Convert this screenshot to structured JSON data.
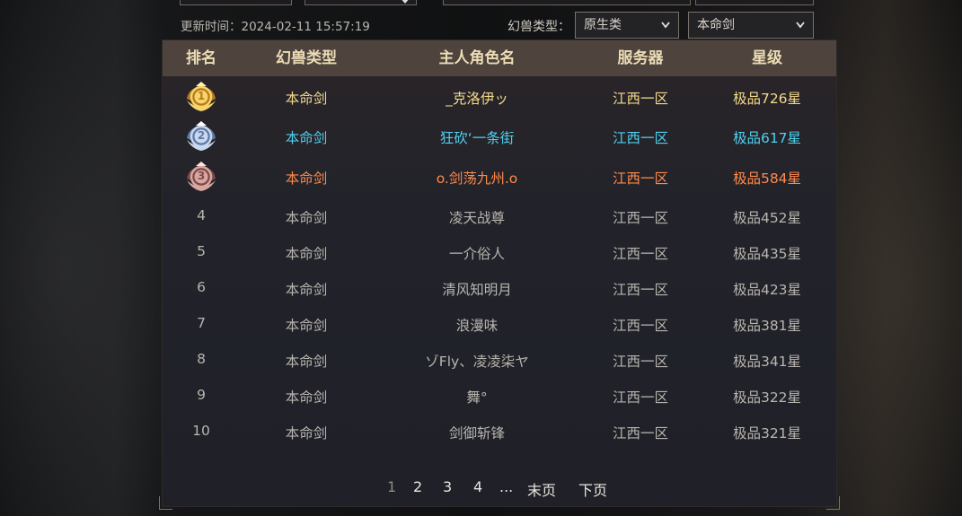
{
  "update_time": "更新时间：2024-02-11 15:57:19",
  "filters": {
    "label": "幻兽类型：",
    "type_select": "原生类",
    "name_select": "本命剑"
  },
  "table": {
    "headers": [
      "排名",
      "幻兽类型",
      "主人角色名",
      "服务器",
      "星级"
    ],
    "rows": [
      {
        "rank": "1",
        "beast_type": "本命剑",
        "owner": "_克洛伊ッ",
        "server": "江西一区",
        "stars": "极品726星",
        "medal": "gold-rank-1-medal"
      },
      {
        "rank": "2",
        "beast_type": "本命剑",
        "owner": "狂砍‘一条街",
        "server": "江西一区",
        "stars": "极品617星",
        "medal": "silver-rank-2-medal"
      },
      {
        "rank": "3",
        "beast_type": "本命剑",
        "owner": "o.剑荡九州.o",
        "server": "江西一区",
        "stars": "极品584星",
        "medal": "bronze-rank-3-medal"
      },
      {
        "rank": "4",
        "beast_type": "本命剑",
        "owner": "凌天战尊",
        "server": "江西一区",
        "stars": "极品452星"
      },
      {
        "rank": "5",
        "beast_type": "本命剑",
        "owner": "一介俗人",
        "server": "江西一区",
        "stars": "极品435星"
      },
      {
        "rank": "6",
        "beast_type": "本命剑",
        "owner": "清风知明月",
        "server": "江西一区",
        "stars": "极品423星"
      },
      {
        "rank": "7",
        "beast_type": "本命剑",
        "owner": "浪漫味",
        "server": "江西一区",
        "stars": "极品381星"
      },
      {
        "rank": "8",
        "beast_type": "本命剑",
        "owner": "ゾFly、凌凌柒ヤ",
        "server": "江西一区",
        "stars": "极品341星"
      },
      {
        "rank": "9",
        "beast_type": "本命剑",
        "owner": "舞°",
        "server": "江西一区",
        "stars": "极品322星"
      },
      {
        "rank": "10",
        "beast_type": "本命剑",
        "owner": "剑御斩锋",
        "server": "江西一区",
        "stars": "极品321星"
      }
    ]
  },
  "pagination": {
    "pages": [
      "1",
      "2",
      "3",
      "4"
    ],
    "current": "1",
    "ellipsis": "...",
    "last_label": "末页",
    "next_label": "下页"
  },
  "colors": {
    "gold": "#f3d98b",
    "cyan": "#4fd0f0",
    "orange": "#ff8a4c",
    "normal": "#b8b5ae",
    "header_text": "#ecdcb6",
    "header_bg": "#4e443d"
  }
}
